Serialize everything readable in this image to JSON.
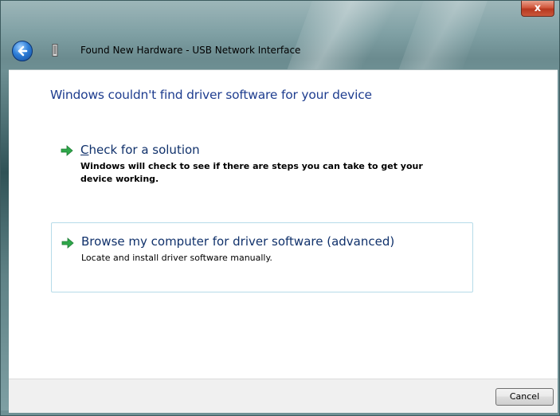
{
  "window": {
    "title": "Found New Hardware - USB Network Interface",
    "close_label": "x"
  },
  "icons": {
    "back": "back-arrow-icon",
    "device": "usb-device-icon",
    "option_arrow": "green-arrow-icon"
  },
  "content": {
    "heading": "Windows couldn't find driver software for your device",
    "options": [
      {
        "title_mnemonic": "C",
        "title_rest": "heck for a solution",
        "description": "Windows will check to see if there are steps you can take to get your device working."
      },
      {
        "title": "Browse my computer for driver software (advanced)",
        "description": "Locate and install driver software manually."
      }
    ]
  },
  "footer": {
    "cancel_label": "Cancel"
  },
  "colors": {
    "heading": "#1e3d8f",
    "link": "#10316b",
    "arrow": "#2fa84a",
    "selection_border": "#b6dbe9",
    "close_button": "#c9573b"
  }
}
